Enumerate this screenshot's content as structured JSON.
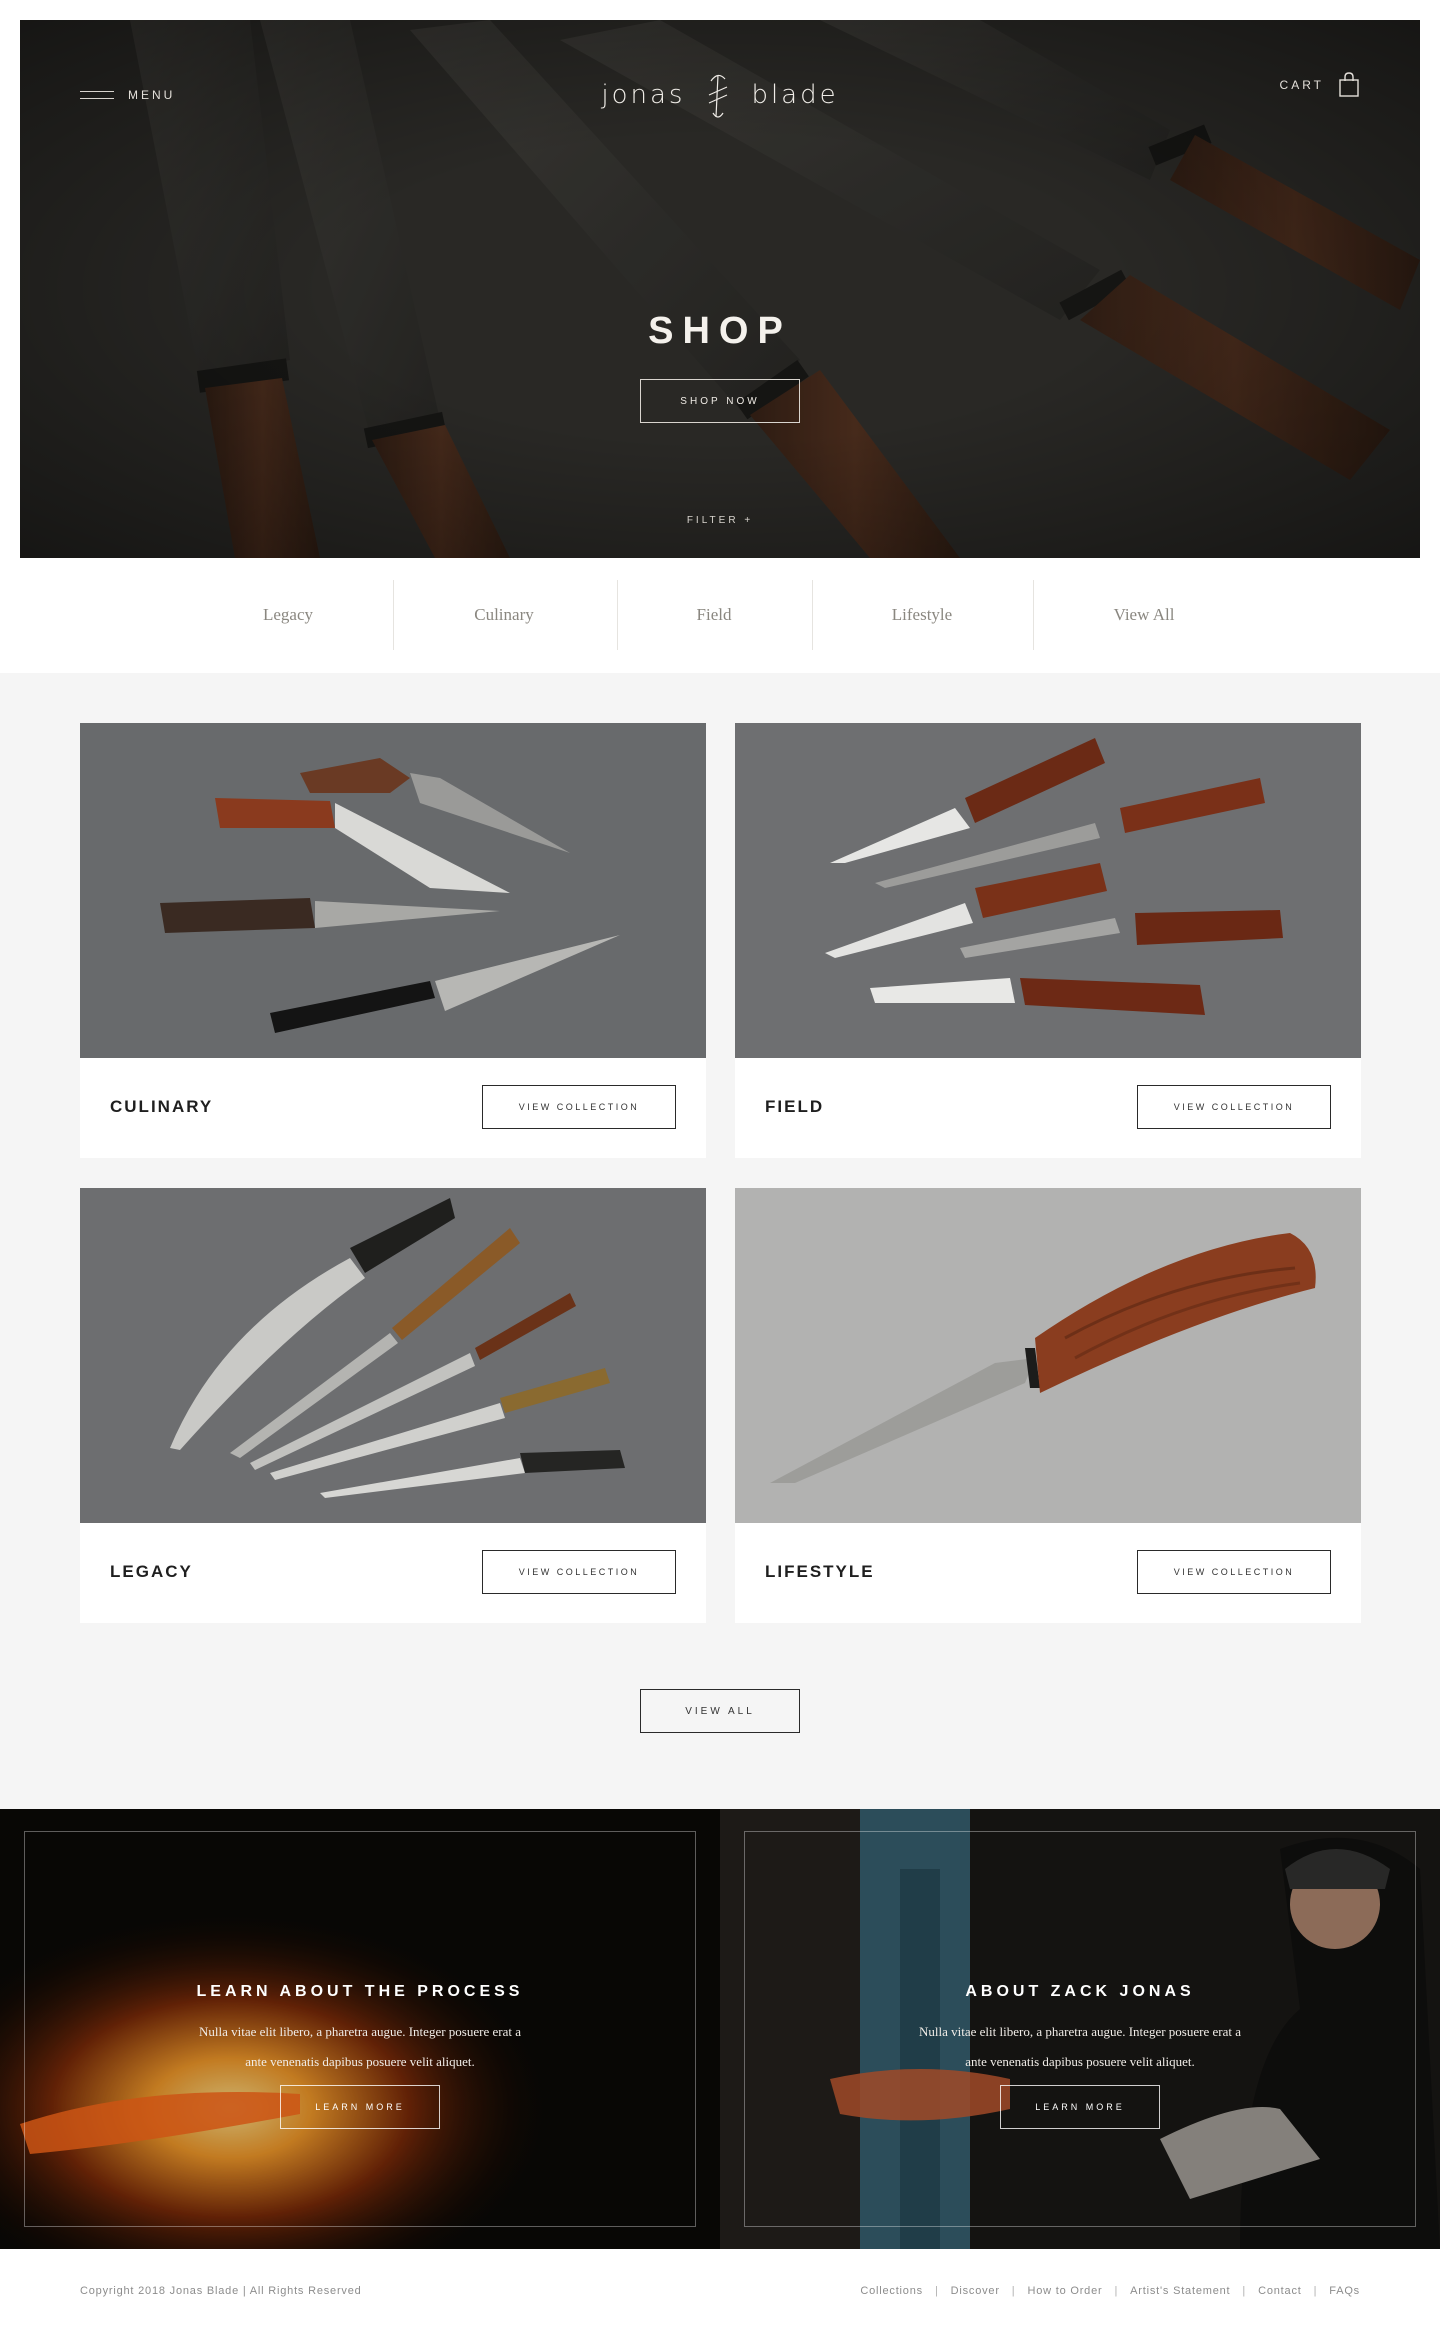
{
  "header": {
    "menu_label": "MENU",
    "logo_left": "jonas",
    "logo_right": "blade",
    "cart_label": "CART"
  },
  "hero": {
    "title": "SHOP",
    "cta_label": "SHOP NOW",
    "filter_label": "FILTER +"
  },
  "categories": {
    "tabs": [
      "Legacy",
      "Culinary",
      "Field",
      "Lifestyle",
      "View All"
    ]
  },
  "collections": {
    "items": [
      {
        "name": "CULINARY",
        "button_label": "VIEW COLLECTION"
      },
      {
        "name": "FIELD",
        "button_label": "VIEW COLLECTION"
      },
      {
        "name": "LEGACY",
        "button_label": "VIEW COLLECTION"
      },
      {
        "name": "LIFESTYLE",
        "button_label": "VIEW COLLECTION"
      }
    ],
    "view_all_label": "VIEW ALL"
  },
  "features": {
    "process": {
      "title": "LEARN ABOUT THE PROCESS",
      "line1": "Nulla vitae elit libero, a pharetra augue. Integer posuere erat a",
      "line2": "ante venenatis dapibus posuere velit aliquet.",
      "button_label": "LEARN MORE"
    },
    "about": {
      "title": "ABOUT ZACK JONAS",
      "line1": "Nulla vitae elit libero, a pharetra augue. Integer posuere erat a",
      "line2": "ante venenatis dapibus posuere velit aliquet.",
      "button_label": "LEARN MORE"
    }
  },
  "footer": {
    "copyright": "Copyright 2018 Jonas Blade | All Rights Reserved",
    "separator": "|",
    "links": [
      "Collections",
      "Discover",
      "How to Order",
      "Artist's Statement",
      "Contact",
      "FAQs"
    ]
  },
  "colors": {
    "hero_bg": "#2f2e2b",
    "grid_bg": "#f5f5f5",
    "text_dark": "#1f1f1f",
    "text_muted": "#8c8c8c"
  }
}
